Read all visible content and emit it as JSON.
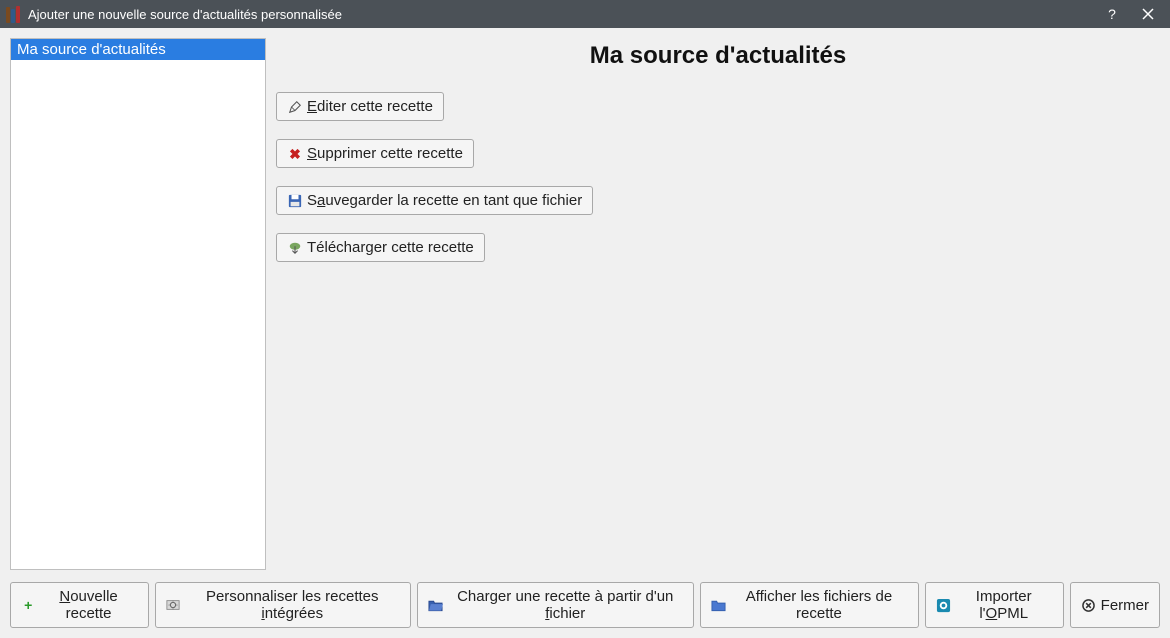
{
  "titlebar": {
    "title": "Ajouter une nouvelle source d'actualités personnalisée"
  },
  "list": {
    "items": [
      "Ma source d'actualités"
    ],
    "selected_index": 0
  },
  "heading": "Ma source d'actualités",
  "actions": {
    "edit_pre": "E",
    "edit_rest": "diter cette recette",
    "delete_pre": "S",
    "delete_rest": "upprimer cette recette",
    "save_pre1": "S",
    "save_pre2": "a",
    "save_rest": "uvegarder la recette en tant que fichier",
    "download": "Télécharger cette recette"
  },
  "bottom": {
    "new_pre": "N",
    "new_rest": "ouvelle recette",
    "customize_pre": "Personnaliser les recettes ",
    "customize_u": "i",
    "customize_rest": "ntégrées",
    "load_pre": "Charger une recette à partir d'un ",
    "load_u": "f",
    "load_rest": "ichier",
    "showfiles": "Afficher les fichiers de recette",
    "import_pre": "Importer l'",
    "import_u": "O",
    "import_rest": "PML",
    "close": "Fermer"
  }
}
